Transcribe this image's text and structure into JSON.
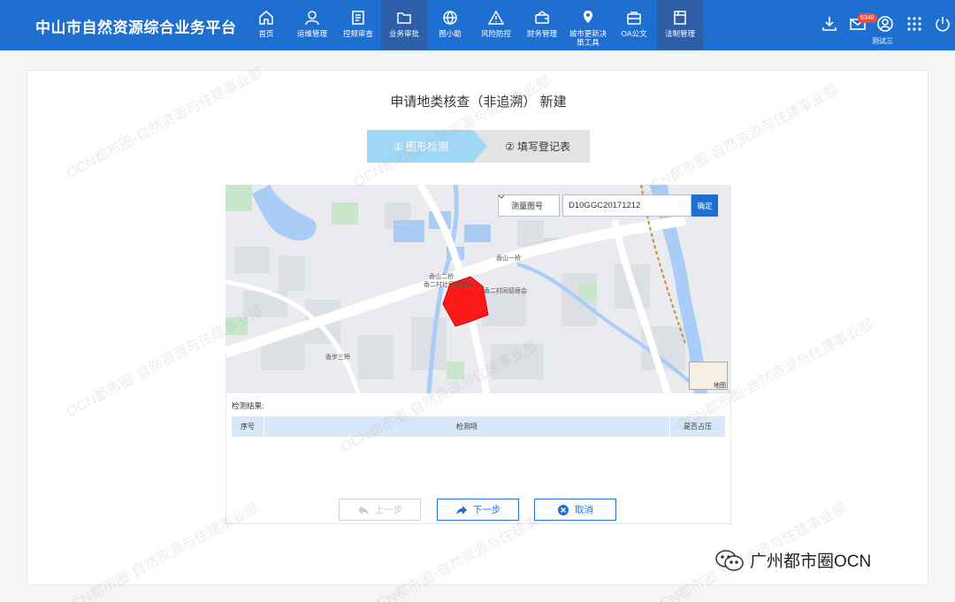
{
  "app": {
    "title": "中山市自然资源综合业务平台"
  },
  "nav": [
    {
      "label": "首页",
      "icon": "home-icon",
      "active": false
    },
    {
      "label": "运维管理",
      "icon": "user-icon",
      "active": false
    },
    {
      "label": "控规审查",
      "icon": "document-icon",
      "active": false
    },
    {
      "label": "业务审批",
      "icon": "folder-icon",
      "active": true
    },
    {
      "label": "图小助",
      "icon": "globe-icon",
      "active": false
    },
    {
      "label": "风险防控",
      "icon": "warning-icon",
      "active": false
    },
    {
      "label": "财务管理",
      "icon": "wallet-icon",
      "active": false
    },
    {
      "label": "城市更新决\n策工具",
      "icon": "location-icon",
      "active": false
    },
    {
      "label": "OA公文",
      "icon": "briefcase-icon",
      "active": false
    },
    {
      "label": "法制管理",
      "icon": "book-icon",
      "active": true
    }
  ],
  "header": {
    "mail_count": "6348",
    "user": "测试三"
  },
  "page": {
    "title": "申请地类核查（非追溯） 新建"
  },
  "steps": [
    {
      "label": "① 图形检测"
    },
    {
      "label": "② 填写登记表"
    }
  ],
  "map": {
    "select_value": "测量图号",
    "input_value": "D10GGC20171212",
    "confirm_label": "确定",
    "thumb_label": "地图",
    "labels": [
      "香山一桥",
      "香山二桥",
      "香二村社区居委会",
      "香二村同德居会",
      "香步三桥"
    ]
  },
  "results": {
    "label": "检测结果:",
    "columns": [
      "序号",
      "检测项",
      "是否占压"
    ]
  },
  "buttons": {
    "prev": "上一步",
    "next": "下一步",
    "cancel": "取消"
  },
  "watermark": "OCN都市圈·自然资源与住建事业部",
  "wechat": "广州都市圈OCN",
  "colors": {
    "primary": "#1f6fd0",
    "active_nav": "#2d5ea8",
    "step_active": "#9fd7f5",
    "parcel": "#ff1a1a"
  }
}
